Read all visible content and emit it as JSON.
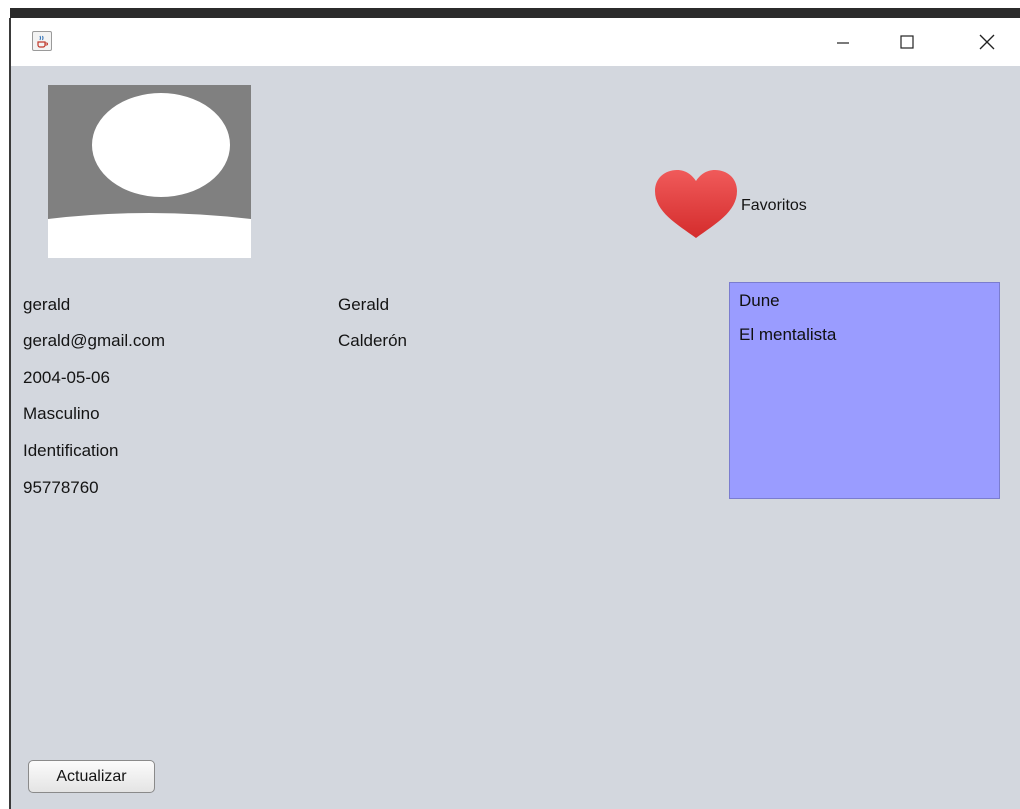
{
  "window": {
    "app_icon": "java-cup-icon",
    "controls": {
      "minimize_icon": "minimize-icon",
      "maximize_icon": "maximize-icon",
      "close_icon": "close-icon"
    }
  },
  "profile": {
    "avatar_icon": "user-avatar-placeholder-icon",
    "username": "gerald",
    "email": "gerald@gmail.com",
    "birthdate": "2004-05-06",
    "gender": "Masculino",
    "id_type": "Identification",
    "id_number": "95778760",
    "first_name": "Gerald",
    "last_name": "Calderón"
  },
  "favorites": {
    "icon": "heart-icon",
    "label": "Favoritos",
    "items": [
      "Dune",
      "El mentalista"
    ],
    "list_color": "#9a9cff"
  },
  "actions": {
    "update_label": "Actualizar"
  }
}
